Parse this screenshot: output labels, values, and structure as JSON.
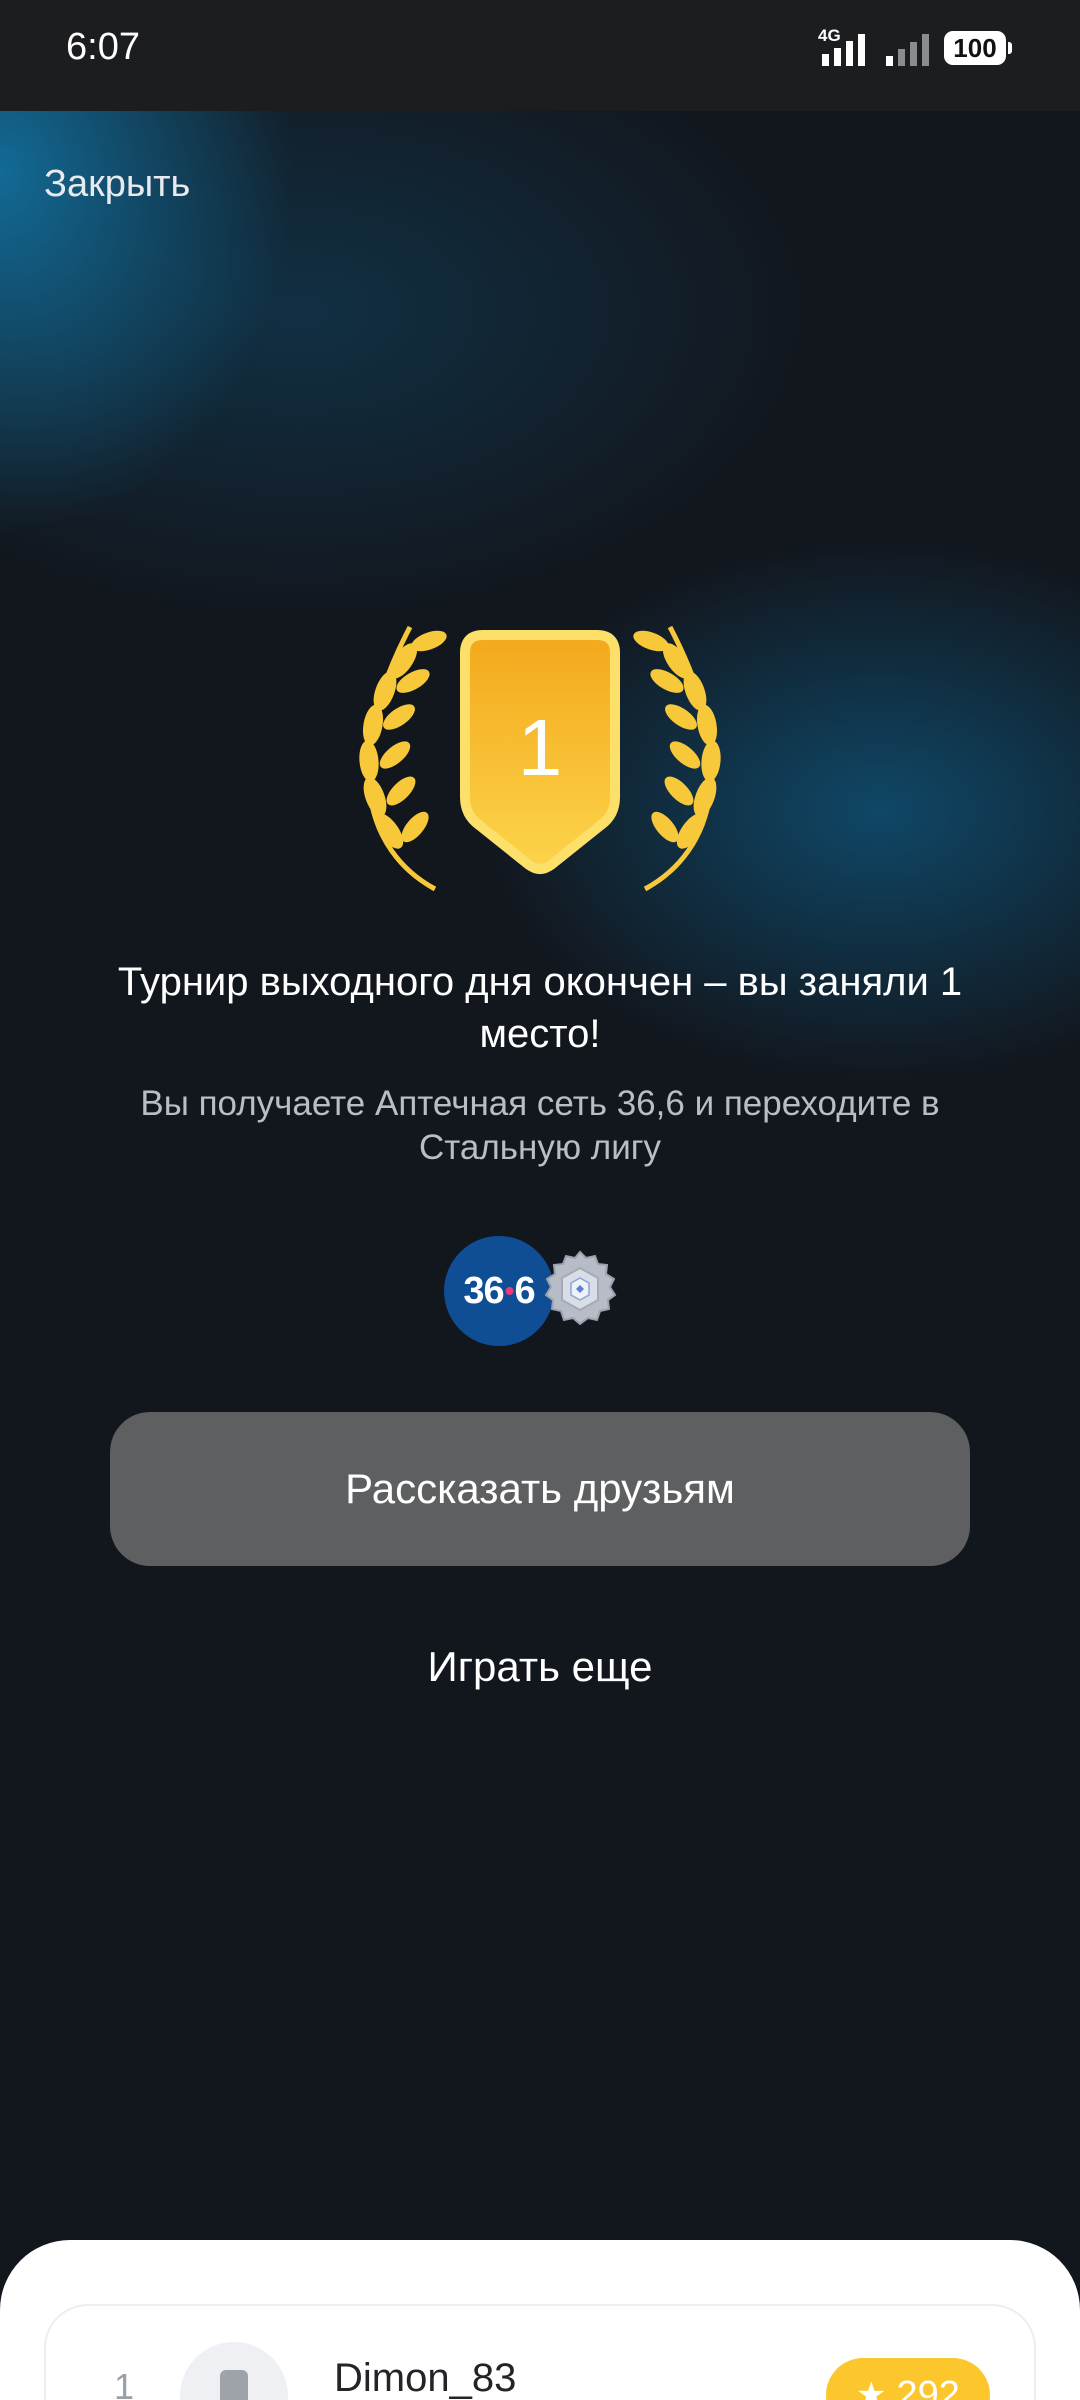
{
  "status_bar": {
    "time": "6:07",
    "network": "4G",
    "battery": "100"
  },
  "header": {
    "close_label": "Закрыть"
  },
  "result": {
    "place_number": "1",
    "title": "Турнир выходного дня окончен – вы заняли 1 место!",
    "subtitle": "Вы получаете Аптечная сеть 36,6 и переходите в Стальную лигу",
    "reward_logo_left": "36",
    "reward_logo_right": "6",
    "reward_logo_dot": "•"
  },
  "actions": {
    "share_label": "Рассказать друзьям",
    "play_again_label": "Играть еще"
  },
  "leaderboard": {
    "rows": [
      {
        "rank": "1",
        "username": "Dimon_83",
        "score": "292"
      }
    ]
  },
  "colors": {
    "gold": "#f7b51f",
    "share_button": "#5e5f61",
    "score_badge": "#fcc72d",
    "reward_logo_bg": "#0f4d94"
  },
  "icons": {
    "trophy": "laurel-shield-icon",
    "league": "steel-league-icon",
    "score": "star-icon"
  }
}
